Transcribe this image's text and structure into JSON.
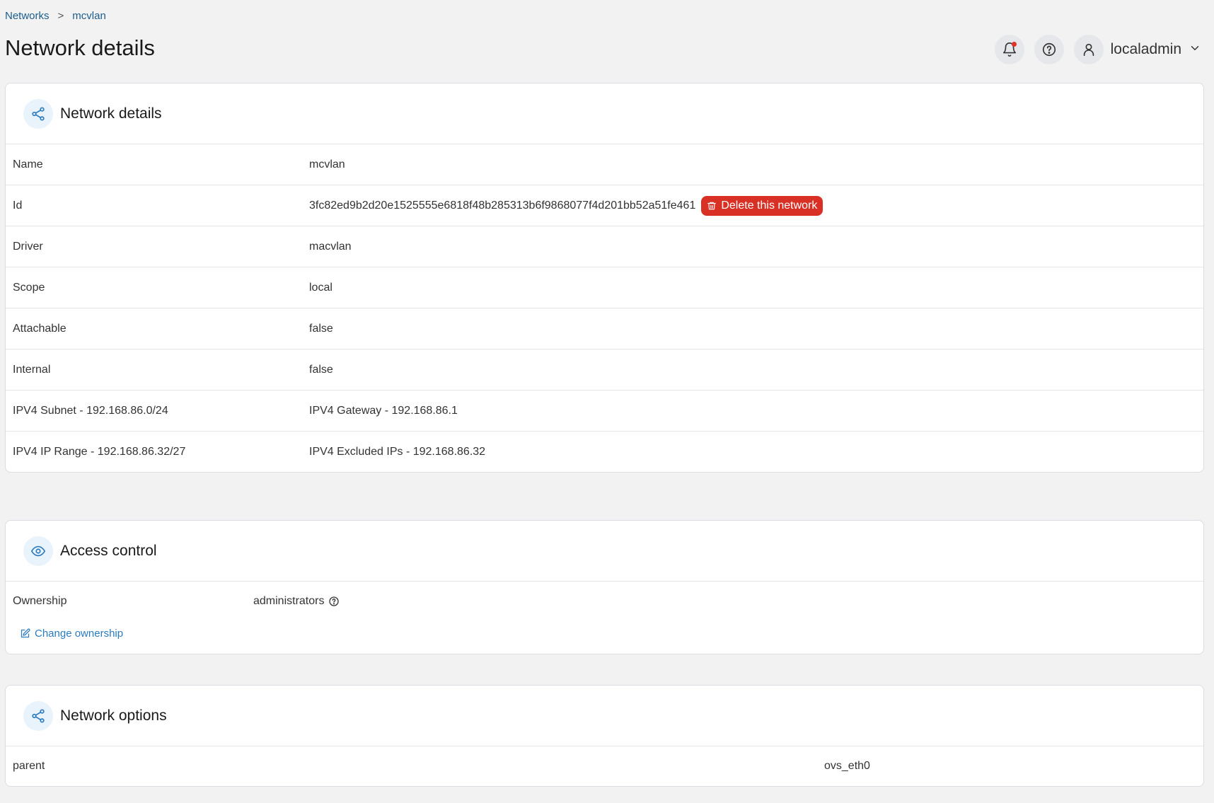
{
  "breadcrumb": {
    "root": "Networks",
    "separator": ">",
    "current": "mcvlan"
  },
  "page_title": "Network details",
  "header": {
    "username": "localadmin"
  },
  "details_card": {
    "title": "Network details",
    "rows": [
      {
        "label": "Name",
        "value": "mcvlan"
      },
      {
        "label": "Id",
        "value": "3fc82ed9b2d20e1525555e6818f48b285313b6f9868077f4d201bb52a51fe461"
      },
      {
        "label": "Driver",
        "value": "macvlan"
      },
      {
        "label": "Scope",
        "value": "local"
      },
      {
        "label": "Attachable",
        "value": "false"
      },
      {
        "label": "Internal",
        "value": "false"
      },
      {
        "label": "IPV4 Subnet - 192.168.86.0/24",
        "value": "IPV4 Gateway - 192.168.86.1"
      },
      {
        "label": "IPV4 IP Range - 192.168.86.32/27",
        "value": "IPV4 Excluded IPs - 192.168.86.32"
      }
    ],
    "delete_label": "Delete this network"
  },
  "access_card": {
    "title": "Access control",
    "ownership_label": "Ownership",
    "ownership_value": "administrators",
    "change_label": "Change ownership"
  },
  "options_card": {
    "title": "Network options",
    "rows": [
      {
        "label": "parent",
        "value": "ovs_eth0"
      }
    ]
  },
  "colors": {
    "accent": "#2b7bbf",
    "danger": "#d93025",
    "link": "#1c5d8c"
  }
}
